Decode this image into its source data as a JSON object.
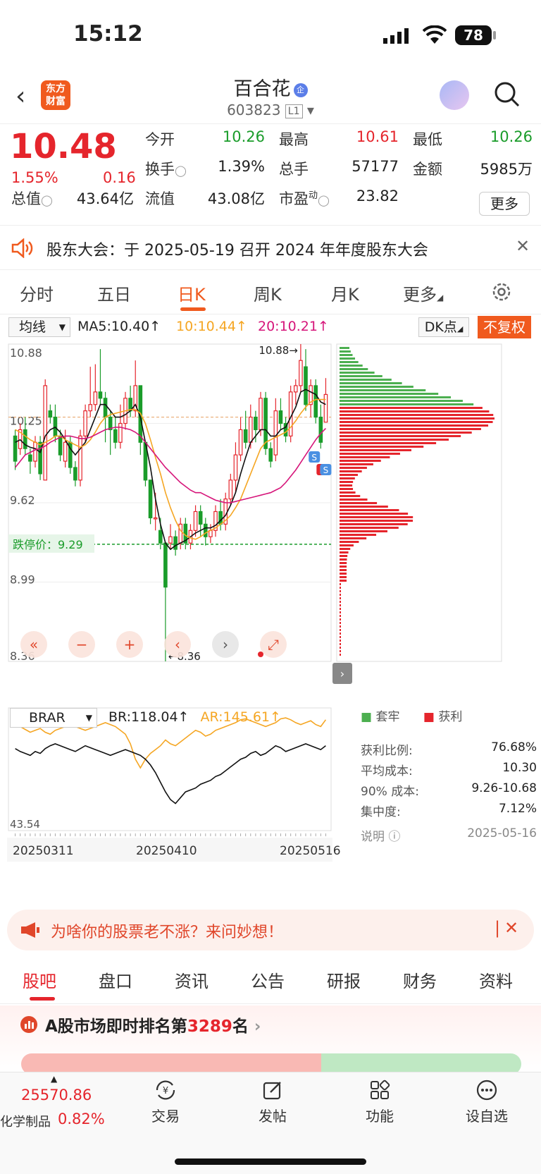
{
  "status": {
    "time": "15:12",
    "battery": "78"
  },
  "header": {
    "logo_line1": "东方",
    "logo_line2": "财富",
    "name": "百合花",
    "badge": "企",
    "code": "603823",
    "level": "L1"
  },
  "quote": {
    "price": "10.48",
    "pct": "1.55%",
    "change": "0.16",
    "open_label": "今开",
    "open": "10.26",
    "high_label": "最高",
    "high": "10.61",
    "low_label": "最低",
    "low": "10.26",
    "turnover_label": "换手",
    "turnover": "1.39%",
    "volume_label": "总手",
    "volume": "57177",
    "amount_label": "金额",
    "amount": "5985万",
    "mcap_label": "总值",
    "mcap": "43.64亿",
    "float_label": "流值",
    "float": "43.08亿",
    "pe_label": "市盈",
    "pe_sup": "动",
    "pe": "23.82",
    "more": "更多"
  },
  "notice": {
    "text": "股东大会：于 2025-05-19 召开 2024 年年度股东大会"
  },
  "tabs": [
    "分时",
    "五日",
    "日K",
    "周K",
    "月K",
    "更多"
  ],
  "kline_bar": {
    "ma_select": "均线",
    "ma5": "MA5:10.40",
    "ma10": "10:10.44",
    "ma20": "20:10.21",
    "dk": "DK点",
    "fq": "不复权"
  },
  "chart_data": {
    "type": "candlestick",
    "y_ticks": [
      "10.88",
      "10.25",
      "9.62",
      "8.99",
      "8.36"
    ],
    "ylim": [
      8.36,
      10.88
    ],
    "high_mark": "10.88",
    "low_mark": "8.36",
    "limit_down_label": "跌停价：",
    "limit_down": "9.29",
    "limit_down_value": 9.29,
    "cost_line": 10.3,
    "candles": [
      [
        10.15,
        9.95,
        10.2,
        9.88
      ],
      [
        10.05,
        10.2,
        10.25,
        10.0
      ],
      [
        10.2,
        10.05,
        10.3,
        10.0
      ],
      [
        10.0,
        9.95,
        10.05,
        9.85
      ],
      [
        9.95,
        10.1,
        10.15,
        9.9
      ],
      [
        10.1,
        9.85,
        10.15,
        9.8
      ],
      [
        9.8,
        10.55,
        10.6,
        9.8
      ],
      [
        10.35,
        10.3,
        10.4,
        10.25
      ],
      [
        10.3,
        10.15,
        10.4,
        10.1
      ],
      [
        10.15,
        10.0,
        10.2,
        9.95
      ],
      [
        9.95,
        10.1,
        10.2,
        9.9
      ],
      [
        10.1,
        9.9,
        10.15,
        9.85
      ],
      [
        9.9,
        9.8,
        9.95,
        9.75
      ],
      [
        9.8,
        10.15,
        10.2,
        9.75
      ],
      [
        10.15,
        10.35,
        10.4,
        10.1
      ],
      [
        10.35,
        10.4,
        10.7,
        10.3
      ],
      [
        10.4,
        10.5,
        10.72,
        10.35
      ],
      [
        10.5,
        10.45,
        10.84,
        10.4
      ],
      [
        10.45,
        10.3,
        10.5,
        10.1
      ],
      [
        10.3,
        10.2,
        10.35,
        10.0
      ],
      [
        10.2,
        10.1,
        10.3,
        10.05
      ],
      [
        10.1,
        10.25,
        10.4,
        10.05
      ],
      [
        10.25,
        10.45,
        10.5,
        10.2
      ],
      [
        10.45,
        10.35,
        10.55,
        10.3
      ],
      [
        10.35,
        10.55,
        10.75,
        10.3
      ],
      [
        10.55,
        10.1,
        10.55,
        10.0
      ],
      [
        10.1,
        9.8,
        10.1,
        9.75
      ],
      [
        9.8,
        9.5,
        9.8,
        9.45
      ],
      [
        9.5,
        9.5,
        9.7,
        9.4
      ],
      [
        9.4,
        9.3,
        9.5,
        9.25
      ],
      [
        9.3,
        8.95,
        9.3,
        8.36
      ],
      [
        9.3,
        9.35,
        9.45,
        9.25
      ],
      [
        9.35,
        9.25,
        9.4,
        9.2
      ],
      [
        9.3,
        9.45,
        9.5,
        9.25
      ],
      [
        9.45,
        9.3,
        9.5,
        9.25
      ],
      [
        9.3,
        9.4,
        9.45,
        9.25
      ],
      [
        9.4,
        9.55,
        9.6,
        9.35
      ],
      [
        9.55,
        9.45,
        9.6,
        9.35
      ],
      [
        9.45,
        9.35,
        9.5,
        9.28
      ],
      [
        9.35,
        9.4,
        9.45,
        9.3
      ],
      [
        9.4,
        9.55,
        9.6,
        9.35
      ],
      [
        9.55,
        9.45,
        9.65,
        9.4
      ],
      [
        9.45,
        9.65,
        9.7,
        9.4
      ],
      [
        9.65,
        9.8,
        9.85,
        9.6
      ],
      [
        9.8,
        10.0,
        10.1,
        9.7
      ],
      [
        10.0,
        10.2,
        10.3,
        9.95
      ],
      [
        10.2,
        10.1,
        10.35,
        10.05
      ],
      [
        10.1,
        10.3,
        10.4,
        10.05
      ],
      [
        10.3,
        10.2,
        10.35,
        10.1
      ],
      [
        10.2,
        10.45,
        10.5,
        10.15
      ],
      [
        10.45,
        10.05,
        10.5,
        10.0
      ],
      [
        10.05,
        9.95,
        10.1,
        9.9
      ],
      [
        10.0,
        10.35,
        10.45,
        9.95
      ],
      [
        10.35,
        10.25,
        10.45,
        10.2
      ],
      [
        10.25,
        10.15,
        10.3,
        10.1
      ],
      [
        10.15,
        10.5,
        10.55,
        10.1
      ],
      [
        10.5,
        10.55,
        10.6,
        10.4
      ],
      [
        10.55,
        10.75,
        10.88,
        10.5
      ],
      [
        10.7,
        10.4,
        10.84,
        10.35
      ],
      [
        10.4,
        10.55,
        10.6,
        10.3
      ],
      [
        10.55,
        10.3,
        10.6,
        10.25
      ],
      [
        10.3,
        10.1,
        10.4,
        10.05
      ],
      [
        10.26,
        10.48,
        10.61,
        10.26
      ]
    ],
    "ma5": [
      10.1,
      10.12,
      10.08,
      10.06,
      10.05,
      10.02,
      10.15,
      10.2,
      10.22,
      10.18,
      10.12,
      10.05,
      10.0,
      10.05,
      10.1,
      10.2,
      10.3,
      10.4,
      10.4,
      10.35,
      10.3,
      10.3,
      10.32,
      10.35,
      10.4,
      10.3,
      10.1,
      9.9,
      9.65,
      9.45,
      9.3,
      9.25,
      9.28,
      9.3,
      9.32,
      9.35,
      9.38,
      9.4,
      9.42,
      9.42,
      9.44,
      9.48,
      9.52,
      9.6,
      9.7,
      9.85,
      9.98,
      10.1,
      10.15,
      10.2,
      10.2,
      10.15,
      10.15,
      10.2,
      10.22,
      10.3,
      10.38,
      10.5,
      10.52,
      10.5,
      10.48,
      10.42,
      10.4
    ],
    "ma10": [
      10.2,
      10.18,
      10.15,
      10.12,
      10.1,
      10.08,
      10.1,
      10.12,
      10.15,
      10.15,
      10.12,
      10.1,
      10.08,
      10.06,
      10.08,
      10.12,
      10.18,
      10.25,
      10.3,
      10.32,
      10.33,
      10.34,
      10.35,
      10.36,
      10.36,
      10.33,
      10.25,
      10.12,
      9.98,
      9.85,
      9.7,
      9.58,
      9.48,
      9.4,
      9.36,
      9.34,
      9.33,
      9.35,
      9.38,
      9.4,
      9.42,
      9.45,
      9.48,
      9.52,
      9.58,
      9.65,
      9.75,
      9.85,
      9.95,
      10.05,
      10.1,
      10.12,
      10.14,
      10.16,
      10.18,
      10.22,
      10.27,
      10.33,
      10.38,
      10.42,
      10.44,
      10.44,
      10.44
    ],
    "ma20": [
      9.9,
      9.95,
      10.0,
      10.02,
      10.04,
      10.05,
      10.07,
      10.1,
      10.12,
      10.14,
      10.15,
      10.15,
      10.14,
      10.13,
      10.13,
      10.14,
      10.16,
      10.18,
      10.2,
      10.21,
      10.22,
      10.22,
      10.21,
      10.2,
      10.18,
      10.15,
      10.1,
      10.05,
      10.0,
      9.95,
      9.9,
      9.86,
      9.82,
      9.78,
      9.75,
      9.72,
      9.7,
      9.7,
      9.68,
      9.66,
      9.64,
      9.63,
      9.62,
      9.62,
      9.63,
      9.64,
      9.65,
      9.66,
      9.67,
      9.68,
      9.69,
      9.7,
      9.72,
      9.74,
      9.78,
      9.83,
      9.88,
      9.94,
      10.0,
      10.06,
      10.12,
      10.17,
      10.21
    ]
  },
  "brar": {
    "select": "BRAR",
    "br": "BR:118.04",
    "ar": "AR:145.61",
    "ytop": "147.51",
    "ybot": "43.54",
    "br_values": [
      115,
      112,
      110,
      108,
      112,
      110,
      115,
      118,
      120,
      118,
      116,
      114,
      112,
      115,
      118,
      116,
      114,
      112,
      110,
      108,
      110,
      112,
      114,
      112,
      110,
      108,
      104,
      98,
      90,
      80,
      70,
      62,
      58,
      64,
      70,
      72,
      74,
      78,
      80,
      82,
      86,
      88,
      92,
      96,
      100,
      104,
      106,
      110,
      112,
      108,
      110,
      114,
      118,
      116,
      112,
      114,
      116,
      118,
      120,
      118,
      116,
      114,
      118
    ],
    "ar_values": [
      140,
      138,
      135,
      132,
      134,
      136,
      132,
      130,
      134,
      136,
      138,
      140,
      138,
      136,
      134,
      136,
      138,
      140,
      142,
      140,
      138,
      134,
      130,
      120,
      104,
      95,
      104,
      110,
      114,
      118,
      124,
      120,
      118,
      122,
      126,
      130,
      134,
      132,
      128,
      130,
      134,
      136,
      138,
      140,
      142,
      145,
      146,
      144,
      142,
      140,
      138,
      140,
      142,
      146,
      147,
      145,
      142,
      140,
      142,
      144,
      140,
      138,
      145
    ],
    "dates": [
      "20250311",
      "20250410",
      "20250516"
    ]
  },
  "side": {
    "legend_trap": "套牢",
    "legend_profit": "获利",
    "rows": [
      {
        "k": "获利比例:",
        "v": "76.68%"
      },
      {
        "k": "平均成本:",
        "v": "10.30"
      },
      {
        "k": "90% 成本:",
        "v": "9.26-10.68"
      },
      {
        "k": "集中度:",
        "v": "7.12%"
      },
      {
        "k": "说明",
        "v": "2025-05-16"
      }
    ]
  },
  "promo": {
    "text": "为啥你的股票老不涨？来问妙想！"
  },
  "bottom_tabs": [
    "股吧",
    "盘口",
    "资讯",
    "公告",
    "研报",
    "财务",
    "资料"
  ],
  "rank": {
    "prefix": "A股市场即时排名第",
    "num": "3289",
    "suffix": "名"
  },
  "bottom_nav": {
    "index_value": "25570.86",
    "index_name": "化学制品",
    "index_pct": "0.82%",
    "items": [
      "交易",
      "发帖",
      "功能",
      "设自选"
    ]
  },
  "colors": {
    "up": "#e5252c",
    "down": "#1a9c2a",
    "accent": "#f05a1e",
    "ma10": "#f5a623",
    "ma20": "#d6157a"
  }
}
